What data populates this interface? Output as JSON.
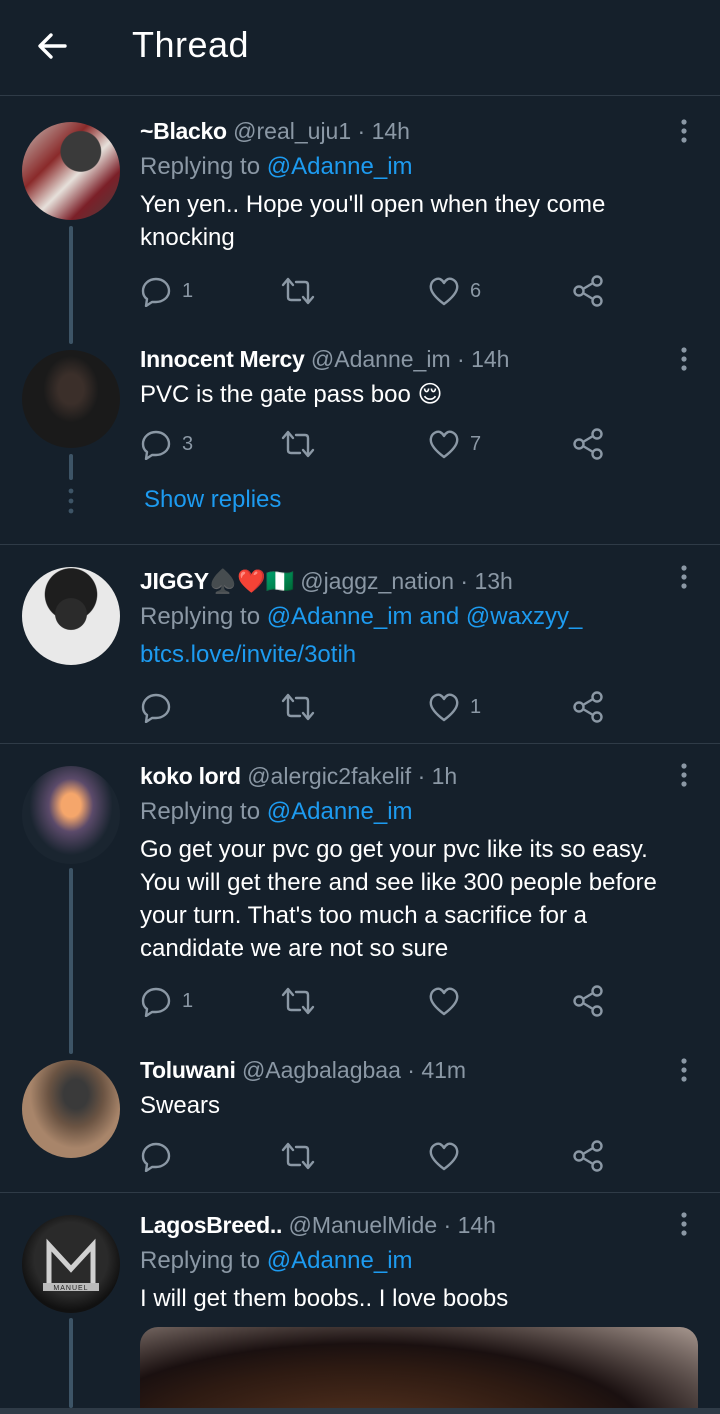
{
  "header": {
    "title": "Thread"
  },
  "tweets": [
    {
      "name": "~Blacko",
      "handle": "@real_uju1",
      "time": "14h",
      "replying_label": "Replying to",
      "replying_to": "@Adanne_im",
      "text": "Yen yen.. Hope you'll open when they come knocking",
      "reply_count": "1",
      "retweet_count": "",
      "like_count": "6"
    },
    {
      "name": "Innocent Mercy",
      "handle": "@Adanne_im",
      "time": "14h",
      "text": "PVC is the gate pass boo 😌",
      "reply_count": "3",
      "retweet_count": "",
      "like_count": "7"
    },
    {
      "name": "JIGGY♠️❤️🇳🇬",
      "handle": "@jaggz_nation",
      "time": "13h",
      "replying_label": "Replying to",
      "replying_to": "@Adanne_im and @waxzyy_",
      "text": "btcs.love/invite/3otih",
      "reply_count": "",
      "retweet_count": "",
      "like_count": "1"
    },
    {
      "name": "koko lord",
      "handle": "@alergic2fakelif",
      "time": "1h",
      "replying_label": "Replying to",
      "replying_to": "@Adanne_im",
      "text": "Go get your pvc go get your pvc like its so easy. You will get there and see like 300 people before your turn. That's too much a sacrifice for a candidate we are not so sure",
      "reply_count": "1",
      "retweet_count": "",
      "like_count": ""
    },
    {
      "name": "Toluwani",
      "handle": "@Aagbalagbaa",
      "time": "41m",
      "text": "Swears",
      "reply_count": "",
      "retweet_count": "",
      "like_count": ""
    },
    {
      "name": "LagosBreed..",
      "handle": "@ManuelMide",
      "time": "14h",
      "replying_label": "Replying to",
      "replying_to": "@Adanne_im",
      "text": "I will get them boobs.. I love boobs",
      "avatar_text": "MANUEL"
    }
  ],
  "show_replies": "Show replies",
  "colors": {
    "background": "#15202b",
    "accent": "#1d9bf0",
    "muted": "#8b98a5",
    "divider": "#2f3b47"
  },
  "icons": [
    "back-arrow-icon",
    "more-icon",
    "reply-icon",
    "retweet-icon",
    "like-icon",
    "share-icon"
  ]
}
